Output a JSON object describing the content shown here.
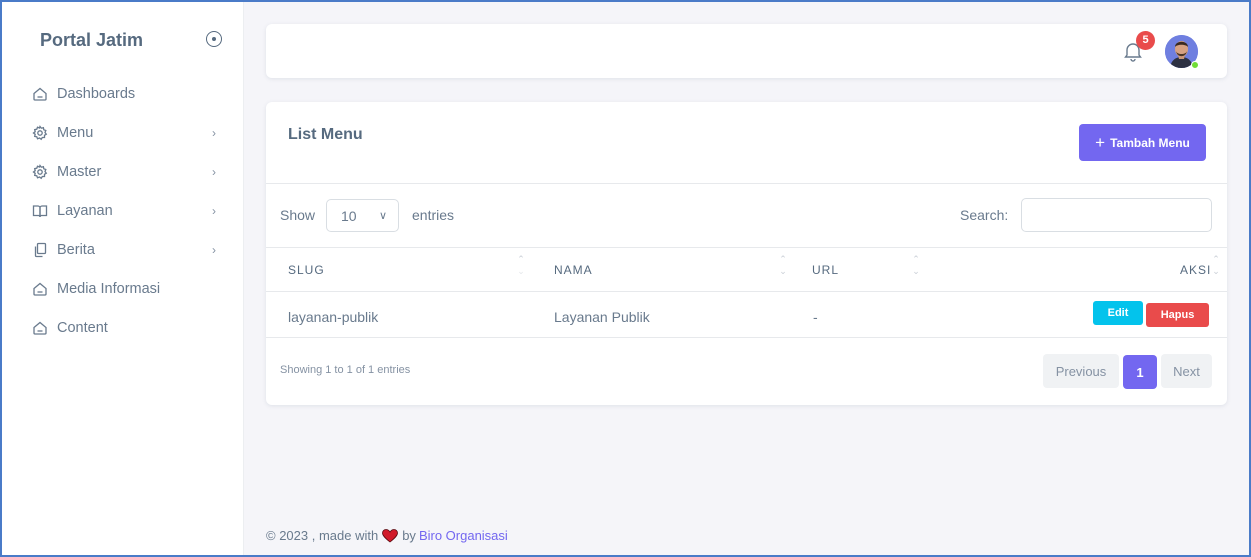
{
  "brand": {
    "title": "Portal Jatim"
  },
  "sidebar": {
    "items": [
      {
        "label": "Dashboards",
        "icon": "home-icon",
        "has_submenu": false
      },
      {
        "label": "Menu",
        "icon": "gear-icon",
        "has_submenu": true
      },
      {
        "label": "Master",
        "icon": "gear-icon",
        "has_submenu": true
      },
      {
        "label": "Layanan",
        "icon": "book-open-icon",
        "has_submenu": true
      },
      {
        "label": "Berita",
        "icon": "copy-icon",
        "has_submenu": true
      },
      {
        "label": "Media Informasi",
        "icon": "home-icon",
        "has_submenu": false
      },
      {
        "label": "Content",
        "icon": "home-icon",
        "has_submenu": false
      }
    ],
    "chevron": "›"
  },
  "navbar": {
    "notification_count": "5"
  },
  "card": {
    "title": "List Menu",
    "add_button": "Tambah Menu",
    "show_label": "Show",
    "page_length": "10",
    "entries_label": "entries",
    "search_label": "Search:",
    "search_value": "",
    "columns": [
      "SLUG",
      "NAMA",
      "URL",
      "AKSI"
    ],
    "rows": [
      {
        "slug": "layanan-publik",
        "nama": "Layanan Publik",
        "url": "-",
        "edit": "Edit",
        "hapus": "Hapus"
      }
    ],
    "info": "Showing 1 to 1 of 1 entries",
    "pagination": {
      "previous": "Previous",
      "current": "1",
      "next": "Next"
    }
  },
  "footer": {
    "text": "© 2023 , made with",
    "by": "by",
    "link": "Biro Organisasi"
  },
  "colors": {
    "primary": "#7367f0",
    "danger": "#e94b4b",
    "info": "#03c3ec",
    "online": "#71dd37"
  }
}
